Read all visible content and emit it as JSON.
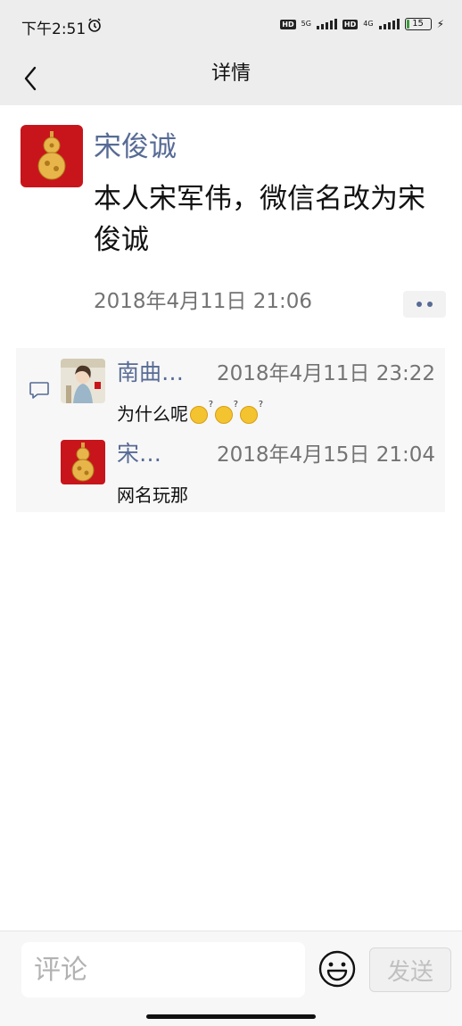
{
  "status_bar": {
    "time": "下午2:51",
    "hd1": "HD",
    "net1": "5G",
    "hd2": "HD",
    "net2": "4G",
    "battery": "15"
  },
  "header": {
    "title": "详情"
  },
  "post": {
    "author": "宋俊诚",
    "text": "本人宋军伟，微信名改为宋俊诚",
    "time": "2018年4月11日  21:06"
  },
  "comments": [
    {
      "name": "南曲…",
      "time": "2018年4月11日  23:22",
      "text": "为什么呢",
      "emoji_count": 3
    },
    {
      "name": "宋…",
      "time": "2018年4月15日  21:04",
      "text": "网名玩那"
    }
  ],
  "input": {
    "placeholder": "评论",
    "send_label": "发送"
  },
  "colors": {
    "link_blue": "#576b95",
    "header_bg": "#ededed",
    "avatar_red": "#c8151b"
  }
}
